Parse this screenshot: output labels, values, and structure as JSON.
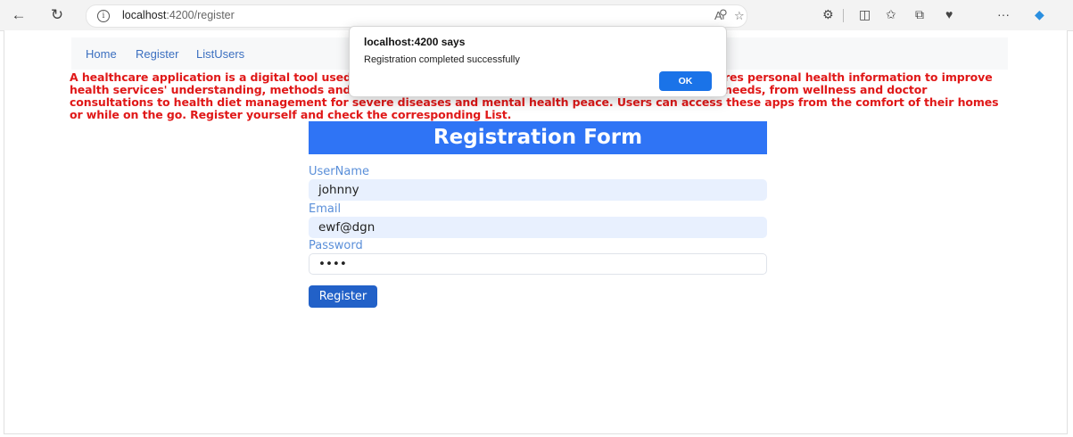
{
  "browser": {
    "url_host": "localhost",
    "url_path": ":4200/register"
  },
  "nav": {
    "home": "Home",
    "register": "Register",
    "list_users": "ListUsers"
  },
  "intro_text": "A healthcare application is a digital tool used to provide healthcare services. It collects, analyzes and stores personal health information to improve health services' understanding, methods and quality of care. These apps cover a range of health-related needs, from wellness and doctor consultations to health diet management for severe diseases and mental health peace. Users can access these apps from the comfort of their homes or while on the go. Register yourself and check the corresponding List.",
  "form": {
    "title": "Registration Form",
    "username_label": "UserName",
    "username_value": "johnny",
    "email_label": "Email",
    "email_value": "ewf@dgn",
    "password_label": "Password",
    "password_value": "••••",
    "submit_label": "Register"
  },
  "dialog": {
    "title": "localhost:4200 says",
    "message": "Registration completed successfully",
    "ok_label": "OK"
  },
  "colors": {
    "header_blue": "#2f74f5",
    "button_blue": "#2261c8",
    "intro_red": "#e01818",
    "label_blue": "#5a8fd9"
  }
}
